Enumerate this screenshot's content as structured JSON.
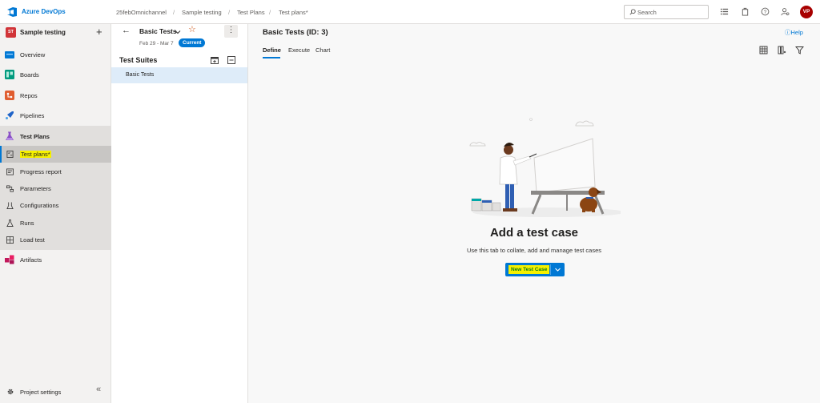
{
  "header": {
    "brand": "Azure DevOps",
    "breadcrumbs": [
      "25febOmnichannel",
      "Sample testing",
      "Test Plans",
      "Test plans*"
    ],
    "search_placeholder": "Search",
    "avatar_initials": "VP"
  },
  "sidebar": {
    "project_badge": "ST",
    "project_name": "Sample testing",
    "items": [
      {
        "label": "Overview",
        "icon": "overview-icon"
      },
      {
        "label": "Boards",
        "icon": "boards-icon"
      },
      {
        "label": "Repos",
        "icon": "repos-icon"
      },
      {
        "label": "Pipelines",
        "icon": "pipelines-icon"
      },
      {
        "label": "Test Plans",
        "icon": "test-plans-icon"
      },
      {
        "label": "Test plans*",
        "icon": "test-plans-list-icon"
      },
      {
        "label": "Progress report",
        "icon": "progress-report-icon"
      },
      {
        "label": "Parameters",
        "icon": "parameters-icon"
      },
      {
        "label": "Configurations",
        "icon": "configurations-icon"
      },
      {
        "label": "Runs",
        "icon": "runs-icon"
      },
      {
        "label": "Load test",
        "icon": "load-test-icon"
      },
      {
        "label": "Artifacts",
        "icon": "artifacts-icon"
      }
    ],
    "footer": {
      "label": "Project settings"
    }
  },
  "plan": {
    "name": "Basic Tests",
    "dates": "Feb 29 - Mar 7",
    "status": "Current",
    "suites_title": "Test Suites",
    "suites": [
      "Basic Tests"
    ]
  },
  "main": {
    "title": "Basic Tests (ID: 3)",
    "help": "Help",
    "tabs": [
      "Define",
      "Execute",
      "Chart"
    ],
    "empty_title": "Add a test case",
    "empty_description": "Use this tab to collate, add and manage test cases",
    "new_button": "New Test Case"
  },
  "colors": {
    "accent": "#0078d4",
    "highlight": "#f6f100",
    "avatar": "#a80000",
    "badge": "#d13438"
  }
}
